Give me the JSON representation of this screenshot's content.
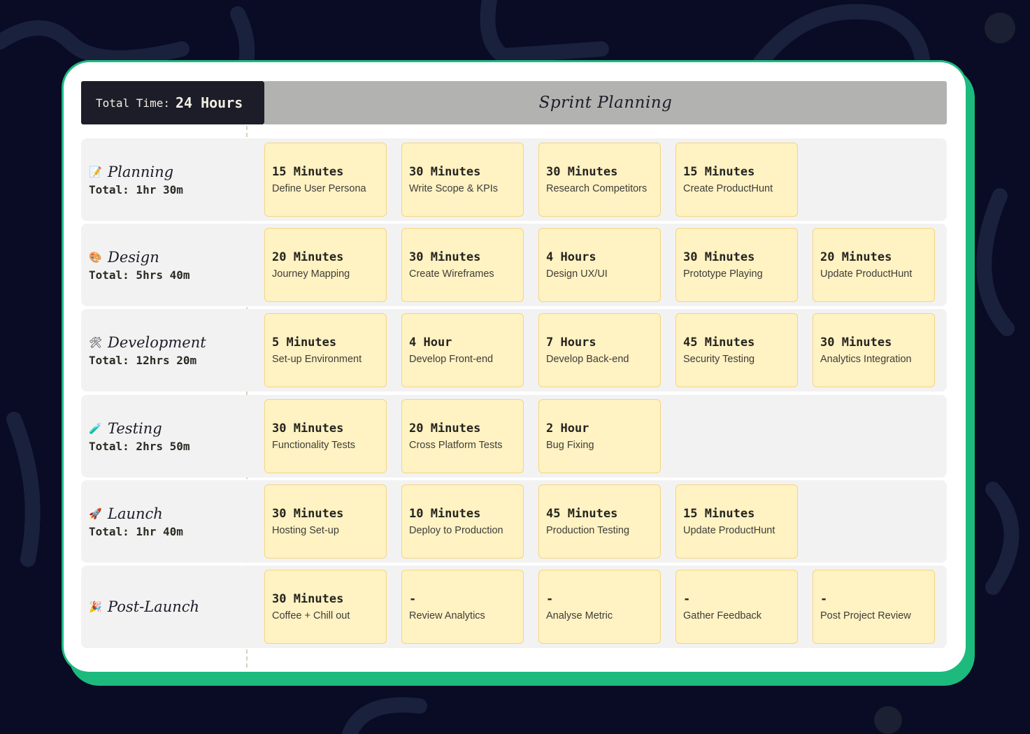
{
  "header": {
    "total_label": "Total Time:",
    "total_value": "24 Hours",
    "title": "Sprint Planning"
  },
  "colors": {
    "background": "#0a0b24",
    "frame_accent": "#1dba7e",
    "card_fill": "#fff2c3",
    "card_border": "#f4d57f",
    "header_dark": "#1c1d29",
    "header_gray": "#b2b2b0"
  },
  "phases": [
    {
      "name": "Planning",
      "icon": "memo-icon",
      "glyph": "📝",
      "total": "Total: 1hr 30m",
      "tasks": [
        {
          "time": "15 Minutes",
          "task": "Define User Persona"
        },
        {
          "time": "30 Minutes",
          "task": "Write Scope & KPIs"
        },
        {
          "time": "30 Minutes",
          "task": "Research Competitors"
        },
        {
          "time": "15 Minutes",
          "task": "Create ProductHunt"
        }
      ]
    },
    {
      "name": "Design",
      "icon": "palette-icon",
      "glyph": "🎨",
      "total": "Total: 5hrs 40m",
      "tasks": [
        {
          "time": "20 Minutes",
          "task": "Journey Mapping"
        },
        {
          "time": "30 Minutes",
          "task": "Create Wireframes"
        },
        {
          "time": "4 Hours",
          "task": "Design UX/UI"
        },
        {
          "time": "30 Minutes",
          "task": "Prototype Playing"
        },
        {
          "time": "20 Minutes",
          "task": "Update ProductHunt"
        }
      ]
    },
    {
      "name": "Development",
      "icon": "tools-icon",
      "glyph": "🛠",
      "total": "Total: 12hrs 20m",
      "tasks": [
        {
          "time": "5 Minutes",
          "task": "Set-up Environment"
        },
        {
          "time": "4 Hour",
          "task": "Develop Front-end"
        },
        {
          "time": "7 Hours",
          "task": "Develop Back-end"
        },
        {
          "time": "45 Minutes",
          "task": "Security Testing"
        },
        {
          "time": "30 Minutes",
          "task": "Analytics Integration"
        }
      ]
    },
    {
      "name": "Testing",
      "icon": "test-tube-icon",
      "glyph": "🧪",
      "total": "Total: 2hrs 50m",
      "tasks": [
        {
          "time": "30 Minutes",
          "task": "Functionality Tests"
        },
        {
          "time": "20 Minutes",
          "task": "Cross Platform Tests"
        },
        {
          "time": "2 Hour",
          "task": "Bug Fixing"
        }
      ]
    },
    {
      "name": "Launch",
      "icon": "rocket-icon",
      "glyph": "🚀",
      "total": "Total: 1hr 40m",
      "tasks": [
        {
          "time": "30 Minutes",
          "task": "Hosting Set-up"
        },
        {
          "time": "10 Minutes",
          "task": "Deploy to Production"
        },
        {
          "time": "45 Minutes",
          "task": "Production Testing"
        },
        {
          "time": "15 Minutes",
          "task": "Update ProductHunt"
        }
      ]
    },
    {
      "name": "Post-Launch",
      "icon": "party-popper-icon",
      "glyph": "🎉",
      "total": "",
      "tasks": [
        {
          "time": "30 Minutes",
          "task": "Coffee + Chill out"
        },
        {
          "time": "-",
          "task": "Review Analytics"
        },
        {
          "time": "-",
          "task": "Analyse Metric"
        },
        {
          "time": "-",
          "task": "Gather Feedback"
        },
        {
          "time": "-",
          "task": "Post Project Review"
        }
      ]
    }
  ]
}
